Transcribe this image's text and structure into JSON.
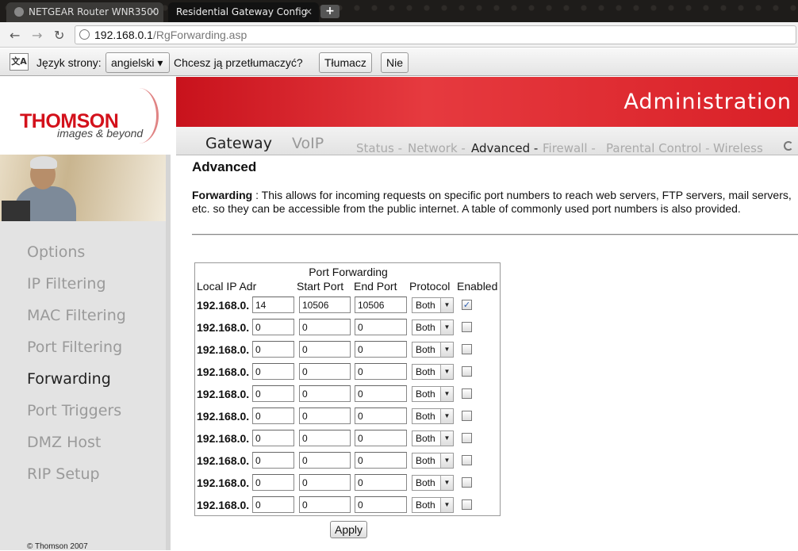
{
  "browser": {
    "tabs": [
      {
        "title": "NETGEAR Router WNR3500",
        "active": false
      },
      {
        "title": "Residential Gateway Config",
        "active": true
      }
    ],
    "new_tab_label": "+",
    "url_host": "192.168.0.1",
    "url_path": "/RgForwarding.asp",
    "nav_icons": [
      "back-arrow",
      "forward-arrow",
      "reload"
    ]
  },
  "translate_bar": {
    "language_label": "Język strony:",
    "language_value": "angielski",
    "question": "Chcesz ją przetłumaczyć?",
    "translate_button": "Tłumacz",
    "no_button": "Nie"
  },
  "header": {
    "logo_text": "THOMSON",
    "logo_tagline": "images & beyond",
    "banner_title": "Administration"
  },
  "nav": {
    "main": [
      "Gateway",
      "VoIP"
    ],
    "sub": [
      {
        "label": "Status -",
        "active": false
      },
      {
        "label": "Network -",
        "active": false
      },
      {
        "label": "Advanced -",
        "active": true
      },
      {
        "label": "Firewall -",
        "active": false
      },
      {
        "label": "Parental Control -",
        "active": false
      },
      {
        "label": "Wireless",
        "active": false
      }
    ]
  },
  "sidebar": {
    "items": [
      {
        "label": "Options",
        "active": false
      },
      {
        "label": "IP Filtering",
        "active": false
      },
      {
        "label": "MAC Filtering",
        "active": false
      },
      {
        "label": "Port Filtering",
        "active": false
      },
      {
        "label": "Forwarding",
        "active": true
      },
      {
        "label": "Port Triggers",
        "active": false
      },
      {
        "label": "DMZ Host",
        "active": false
      },
      {
        "label": "RIP Setup",
        "active": false
      }
    ],
    "footer": "© Thomson 2007"
  },
  "content": {
    "title": "Advanced",
    "desc_term": "Forwarding",
    "desc_text": " : This allows for incoming requests on specific port numbers to reach web servers, FTP servers, mail servers, etc. so they can be accessible from the public internet. A table of commonly used port numbers is also provided."
  },
  "port_forwarding": {
    "title": "Port Forwarding",
    "headers": {
      "local_ip": "Local IP Adr",
      "start_port": "Start Port",
      "end_port": "End Port",
      "protocol": "Protocol",
      "enabled": "Enabled"
    },
    "ip_prefix": "192.168.0.",
    "rows": [
      {
        "ip": "14",
        "start": "10506",
        "end": "10506",
        "protocol": "Both",
        "enabled": true
      },
      {
        "ip": "0",
        "start": "0",
        "end": "0",
        "protocol": "Both",
        "enabled": false
      },
      {
        "ip": "0",
        "start": "0",
        "end": "0",
        "protocol": "Both",
        "enabled": false
      },
      {
        "ip": "0",
        "start": "0",
        "end": "0",
        "protocol": "Both",
        "enabled": false
      },
      {
        "ip": "0",
        "start": "0",
        "end": "0",
        "protocol": "Both",
        "enabled": false
      },
      {
        "ip": "0",
        "start": "0",
        "end": "0",
        "protocol": "Both",
        "enabled": false
      },
      {
        "ip": "0",
        "start": "0",
        "end": "0",
        "protocol": "Both",
        "enabled": false
      },
      {
        "ip": "0",
        "start": "0",
        "end": "0",
        "protocol": "Both",
        "enabled": false
      },
      {
        "ip": "0",
        "start": "0",
        "end": "0",
        "protocol": "Both",
        "enabled": false
      },
      {
        "ip": "0",
        "start": "0",
        "end": "0",
        "protocol": "Both",
        "enabled": false
      }
    ],
    "apply_label": "Apply"
  },
  "colors": {
    "brand_red": "#d3111b",
    "banner_red": "#e63a3f",
    "sidebar_bg": "#e3e3e3",
    "inactive_text": "#9a9a9a"
  }
}
